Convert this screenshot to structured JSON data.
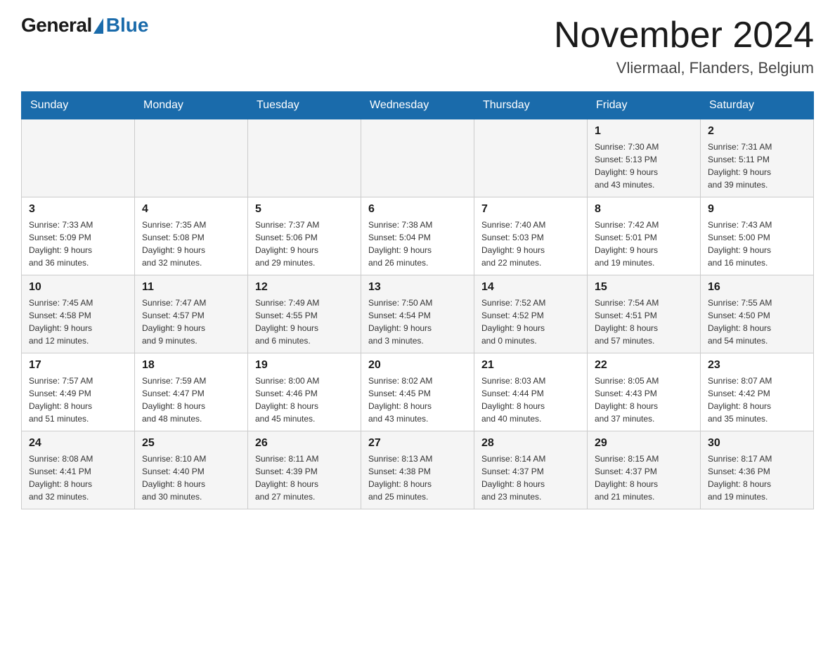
{
  "logo": {
    "general": "General",
    "blue": "Blue"
  },
  "title": "November 2024",
  "location": "Vliermaal, Flanders, Belgium",
  "days_of_week": [
    "Sunday",
    "Monday",
    "Tuesday",
    "Wednesday",
    "Thursday",
    "Friday",
    "Saturday"
  ],
  "weeks": [
    [
      {
        "day": "",
        "info": ""
      },
      {
        "day": "",
        "info": ""
      },
      {
        "day": "",
        "info": ""
      },
      {
        "day": "",
        "info": ""
      },
      {
        "day": "",
        "info": ""
      },
      {
        "day": "1",
        "info": "Sunrise: 7:30 AM\nSunset: 5:13 PM\nDaylight: 9 hours\nand 43 minutes."
      },
      {
        "day": "2",
        "info": "Sunrise: 7:31 AM\nSunset: 5:11 PM\nDaylight: 9 hours\nand 39 minutes."
      }
    ],
    [
      {
        "day": "3",
        "info": "Sunrise: 7:33 AM\nSunset: 5:09 PM\nDaylight: 9 hours\nand 36 minutes."
      },
      {
        "day": "4",
        "info": "Sunrise: 7:35 AM\nSunset: 5:08 PM\nDaylight: 9 hours\nand 32 minutes."
      },
      {
        "day": "5",
        "info": "Sunrise: 7:37 AM\nSunset: 5:06 PM\nDaylight: 9 hours\nand 29 minutes."
      },
      {
        "day": "6",
        "info": "Sunrise: 7:38 AM\nSunset: 5:04 PM\nDaylight: 9 hours\nand 26 minutes."
      },
      {
        "day": "7",
        "info": "Sunrise: 7:40 AM\nSunset: 5:03 PM\nDaylight: 9 hours\nand 22 minutes."
      },
      {
        "day": "8",
        "info": "Sunrise: 7:42 AM\nSunset: 5:01 PM\nDaylight: 9 hours\nand 19 minutes."
      },
      {
        "day": "9",
        "info": "Sunrise: 7:43 AM\nSunset: 5:00 PM\nDaylight: 9 hours\nand 16 minutes."
      }
    ],
    [
      {
        "day": "10",
        "info": "Sunrise: 7:45 AM\nSunset: 4:58 PM\nDaylight: 9 hours\nand 12 minutes."
      },
      {
        "day": "11",
        "info": "Sunrise: 7:47 AM\nSunset: 4:57 PM\nDaylight: 9 hours\nand 9 minutes."
      },
      {
        "day": "12",
        "info": "Sunrise: 7:49 AM\nSunset: 4:55 PM\nDaylight: 9 hours\nand 6 minutes."
      },
      {
        "day": "13",
        "info": "Sunrise: 7:50 AM\nSunset: 4:54 PM\nDaylight: 9 hours\nand 3 minutes."
      },
      {
        "day": "14",
        "info": "Sunrise: 7:52 AM\nSunset: 4:52 PM\nDaylight: 9 hours\nand 0 minutes."
      },
      {
        "day": "15",
        "info": "Sunrise: 7:54 AM\nSunset: 4:51 PM\nDaylight: 8 hours\nand 57 minutes."
      },
      {
        "day": "16",
        "info": "Sunrise: 7:55 AM\nSunset: 4:50 PM\nDaylight: 8 hours\nand 54 minutes."
      }
    ],
    [
      {
        "day": "17",
        "info": "Sunrise: 7:57 AM\nSunset: 4:49 PM\nDaylight: 8 hours\nand 51 minutes."
      },
      {
        "day": "18",
        "info": "Sunrise: 7:59 AM\nSunset: 4:47 PM\nDaylight: 8 hours\nand 48 minutes."
      },
      {
        "day": "19",
        "info": "Sunrise: 8:00 AM\nSunset: 4:46 PM\nDaylight: 8 hours\nand 45 minutes."
      },
      {
        "day": "20",
        "info": "Sunrise: 8:02 AM\nSunset: 4:45 PM\nDaylight: 8 hours\nand 43 minutes."
      },
      {
        "day": "21",
        "info": "Sunrise: 8:03 AM\nSunset: 4:44 PM\nDaylight: 8 hours\nand 40 minutes."
      },
      {
        "day": "22",
        "info": "Sunrise: 8:05 AM\nSunset: 4:43 PM\nDaylight: 8 hours\nand 37 minutes."
      },
      {
        "day": "23",
        "info": "Sunrise: 8:07 AM\nSunset: 4:42 PM\nDaylight: 8 hours\nand 35 minutes."
      }
    ],
    [
      {
        "day": "24",
        "info": "Sunrise: 8:08 AM\nSunset: 4:41 PM\nDaylight: 8 hours\nand 32 minutes."
      },
      {
        "day": "25",
        "info": "Sunrise: 8:10 AM\nSunset: 4:40 PM\nDaylight: 8 hours\nand 30 minutes."
      },
      {
        "day": "26",
        "info": "Sunrise: 8:11 AM\nSunset: 4:39 PM\nDaylight: 8 hours\nand 27 minutes."
      },
      {
        "day": "27",
        "info": "Sunrise: 8:13 AM\nSunset: 4:38 PM\nDaylight: 8 hours\nand 25 minutes."
      },
      {
        "day": "28",
        "info": "Sunrise: 8:14 AM\nSunset: 4:37 PM\nDaylight: 8 hours\nand 23 minutes."
      },
      {
        "day": "29",
        "info": "Sunrise: 8:15 AM\nSunset: 4:37 PM\nDaylight: 8 hours\nand 21 minutes."
      },
      {
        "day": "30",
        "info": "Sunrise: 8:17 AM\nSunset: 4:36 PM\nDaylight: 8 hours\nand 19 minutes."
      }
    ]
  ]
}
